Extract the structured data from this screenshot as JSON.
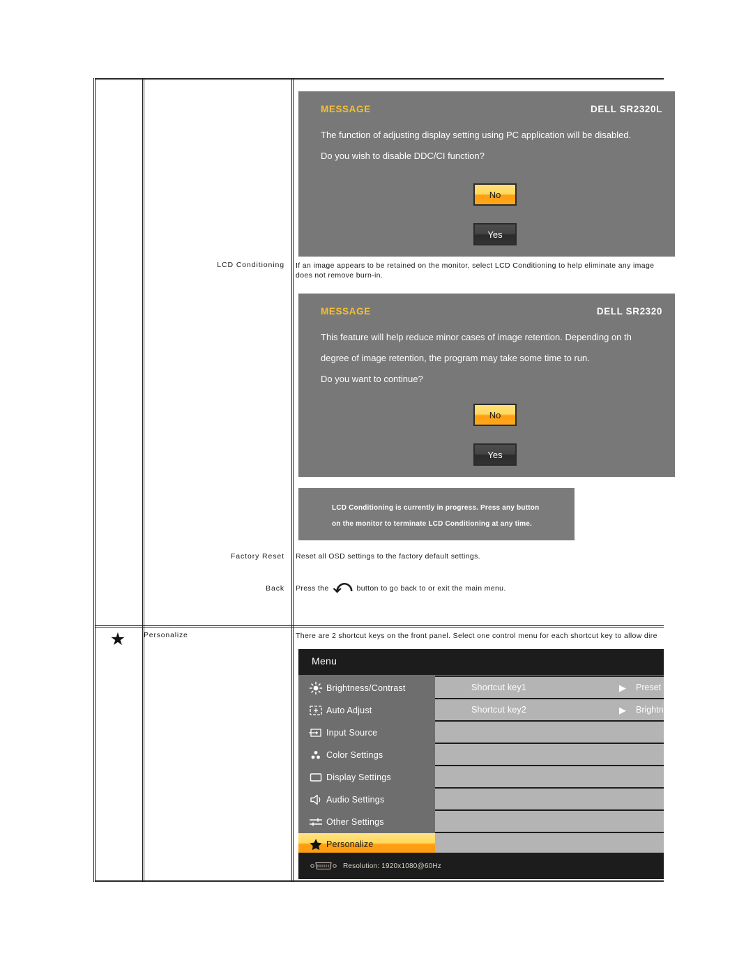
{
  "document": {
    "rows": [
      {
        "label": "LCD Conditioning",
        "description_line1": "If an image appears to be retained on the monitor, select LCD Conditioning to help eliminate any image",
        "description_line2": "does not remove burn-in."
      },
      {
        "label": "Factory Reset",
        "description": "Reset all OSD settings to the factory default settings."
      },
      {
        "label": "Back",
        "description_before": "Press the",
        "back_icon": "back-arrow-icon",
        "description_after": "button to go back to or exit the main menu."
      },
      {
        "label": "Personalize",
        "icon": "star-icon",
        "description": "There are 2 shortcut keys on the front panel. Select one control menu for each shortcut key to allow dire"
      }
    ]
  },
  "message_ddcci": {
    "title": "MESSAGE",
    "model": "DELL  SR2320L",
    "line1": "The function of adjusting display setting using PC application will be disabled.",
    "line2": "Do you wish to disable DDC/CI function?",
    "button_no": "No",
    "button_yes": "Yes"
  },
  "message_conditioning": {
    "title": "MESSAGE",
    "model": "DELL  SR2320",
    "line1": "This feature will help reduce minor cases of image retention. Depending on th",
    "line2": "degree of image retention, the program may take some time to run.",
    "line3": "Do you want to continue?",
    "button_no": "No",
    "button_yes": "Yes"
  },
  "message_progress": {
    "line1": "LCD Conditioning is currently in progress. Press any button",
    "line2": "on the monitor to terminate LCD Conditioning at any time."
  },
  "osd_menu": {
    "title": "Menu",
    "items": [
      {
        "label": "Brightness/Contrast",
        "icon": "brightness-icon",
        "selected": false
      },
      {
        "label": "Auto Adjust",
        "icon": "auto-adjust-icon",
        "selected": false
      },
      {
        "label": "Input Source",
        "icon": "input-source-icon",
        "selected": false
      },
      {
        "label": "Color Settings",
        "icon": "color-settings-icon",
        "selected": false
      },
      {
        "label": "Display Settings",
        "icon": "display-settings-icon",
        "selected": false
      },
      {
        "label": "Audio Settings",
        "icon": "audio-settings-icon",
        "selected": false
      },
      {
        "label": "Other Settings",
        "icon": "other-settings-icon",
        "selected": false
      },
      {
        "label": "Personalize",
        "icon": "star-icon",
        "selected": true
      }
    ],
    "right_rows": [
      {
        "label": "Shortcut key1",
        "arrow": "▶",
        "value": "Preset "
      },
      {
        "label": "Shortcut key2",
        "arrow": "▶",
        "value": "Brightne"
      },
      {
        "label": "",
        "arrow": "",
        "value": ""
      },
      {
        "label": "",
        "arrow": "",
        "value": ""
      },
      {
        "label": "",
        "arrow": "",
        "value": ""
      },
      {
        "label": "",
        "arrow": "",
        "value": ""
      },
      {
        "label": "",
        "arrow": "",
        "value": ""
      },
      {
        "label": "",
        "arrow": "",
        "value": ""
      }
    ],
    "footer": {
      "icon": "vga-connector-icon",
      "resolution": "Resolution:  1920x1080@60Hz"
    }
  },
  "colors": {
    "osd_background": "#787878",
    "accent_yellow": "#f5c030",
    "highlight_orange": "#ff9d10",
    "menu_dark": "#1c1c1c",
    "menu_left": "#6e6e6e",
    "menu_right_row": "#b4b4b4"
  }
}
